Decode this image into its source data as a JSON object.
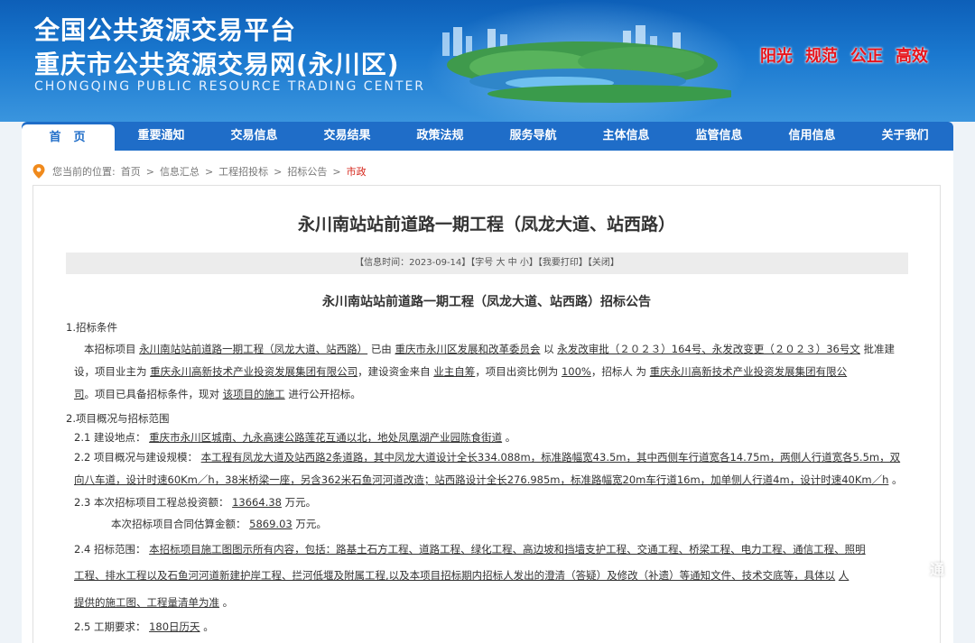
{
  "header": {
    "title_line1": "全国公共资源交易平台",
    "title_line2": "重庆市公共资源交易网(永川区)",
    "subtitle": "CHONGQING PUBLIC RESOURCE TRADING CENTER",
    "slogans": [
      "阳光",
      "规范",
      "公正",
      "高效"
    ]
  },
  "nav": {
    "items": [
      "首页",
      "重要通知",
      "交易信息",
      "交易结果",
      "政策法规",
      "服务导航",
      "主体信息",
      "监管信息",
      "信用信息",
      "关于我们"
    ],
    "active_index": 0
  },
  "breadcrumb": {
    "prefix": "您当前的位置:",
    "items": [
      "首页",
      "信息汇总",
      "工程招投标",
      "招标公告",
      "市政"
    ],
    "separator": ">"
  },
  "article": {
    "title": "永川南站站前道路一期工程（凤龙大道、站西路）",
    "meta": {
      "time": "【信息时间：2023-09-14】",
      "font_label": "【字号",
      "font_large": "大",
      "font_mid": "中",
      "font_small": "小】",
      "print": "【我要打印】",
      "close": "【关闭】"
    },
    "notice_title": "永川南站站前道路一期工程（凤龙大道、站西路）招标公告"
  },
  "sections": {
    "s1_heading": "1.招标条件",
    "s1_text": {
      "a": "本招标项目",
      "b": "永川南站站前道路一期工程（凤龙大道、站西路）",
      "c": "已由",
      "d": "重庆市永川区发展和改革委员会",
      "e": "以",
      "f": "永发改审批（２０２３）164号、永发改变更（２０２３）36号文",
      "g": "批准建",
      "h": "设，项目业主为",
      "i": "重庆永川高新技术产业投资发展集团有限公司",
      "j": "，建设资金来自",
      "k": "业主自筹",
      "l": "，项目出资比例为",
      "m": "100%",
      "n": "，招标人",
      "o": "为",
      "p": "重庆永川高新技术产业投资发展集团有限公",
      "q": "司",
      "r": "。项目已具备招标条件，现对",
      "s": "该项目的施工",
      "t": "进行公开招标。"
    },
    "s2_heading": "2.项目概况与招标范围",
    "s21_label": "2.1  建设地点：",
    "s21_value": "重庆市永川区城南、九永高速公路莲花互通以北，地处凤凰湖产业园陈食街道",
    "s21_end": "。",
    "s22_label": "2.2  项目概况与建设规模：",
    "s22_value_1": "本工程有凤龙大道及站西路2条道路，其中凤龙大道设计全长334.088m，标准路幅宽43.5m，其中西侧车行道宽各14.75m，两侧人行道宽各5.5m，双",
    "s22_value_2": "向八车道，设计时速60Km／h，38米桥梁一座，另含362米石鱼河河道改造；站西路设计全长276.985m，标准路幅宽20m车行道16m，加单侧人行道4m，设计时速40Km／h",
    "s22_end": "。",
    "s23_label": "2.3  本次招标项目工程总投资额：",
    "s23_value": "13664.38",
    "s23_unit": "万元。",
    "s23b_label": "本次招标项目合同估算金额：",
    "s23b_value": "5869.03",
    "s23b_unit": "万元。",
    "s24_label": "2.4  招标范围：",
    "s24_value_1": "本招标项目施工图图示所有内容，包括：路基土石方工程、道路工程、绿化工程、高边坡和挡墙支护工程、交通工程、桥梁工程、电力工程、通信工程、照明",
    "s24_value_2": "工程、排水工程以及石鱼河河道新建护岸工程、拦河低堰及附属工程,以及本项目招标期内招标人发出的澄清（答疑）及修改（补遗）等通知文件、技术交底等，具体以",
    "s24_value_2b": "人",
    "s24_value_3": "提供的施工图、工程量清单为准",
    "s24_end": "。",
    "s25_label": "2.5  工期要求：",
    "s25_value": "180日历天",
    "s25_end": "。"
  },
  "watermark": "通"
}
